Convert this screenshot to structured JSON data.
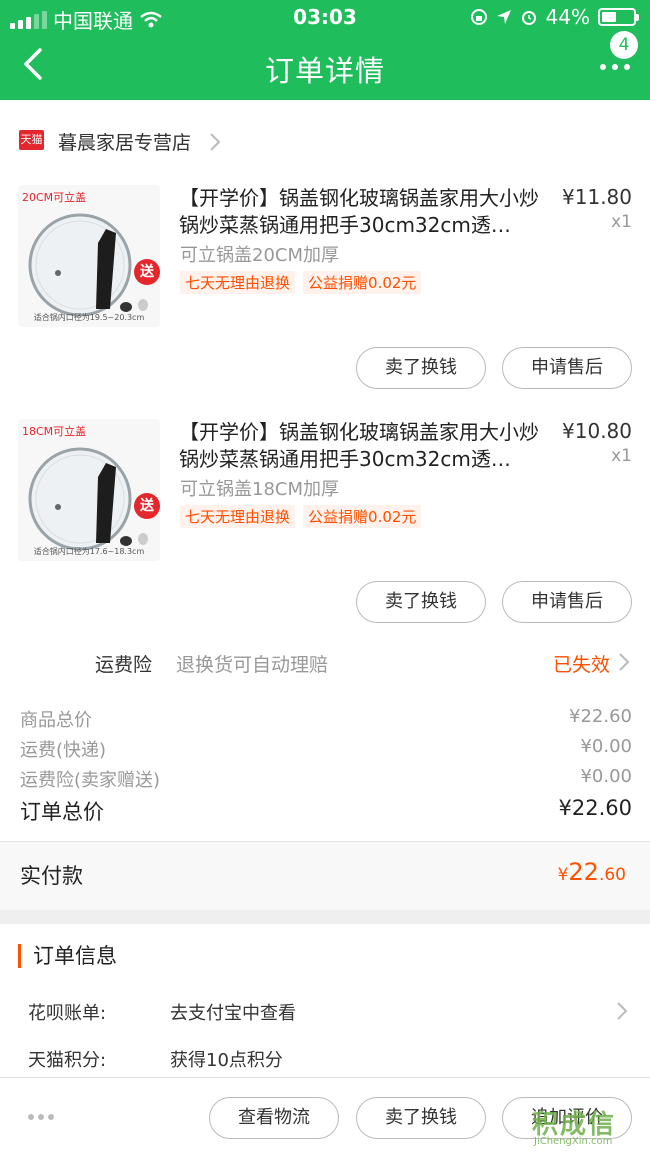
{
  "status_bar": {
    "carrier": "中国联通",
    "time": "03:03",
    "battery": "44%",
    "battery_level": 0.44
  },
  "nav": {
    "title": "订单详情",
    "badge": "4"
  },
  "shop": {
    "logo_text": "天猫",
    "name": "暮晨家居专营店"
  },
  "items": [
    {
      "title": "【开学价】锅盖钢化玻璃锅盖家用大小炒锅炒菜蒸锅通用把手30cm32cm透…",
      "price": "¥11.80",
      "qty": "x1",
      "sku": "可立锅盖20CM加厚",
      "tags": [
        "七天无理由退换",
        "公益捐赠0.02元"
      ],
      "thumb_label": "20CM可立盖",
      "thumb_note": "适合锅内口径为19.5~20.3cm",
      "thumb_gift": "送",
      "actions": [
        "卖了换钱",
        "申请售后"
      ]
    },
    {
      "title": "【开学价】锅盖钢化玻璃锅盖家用大小炒锅炒菜蒸锅通用把手30cm32cm透…",
      "price": "¥10.80",
      "qty": "x1",
      "sku": "可立锅盖18CM加厚",
      "tags": [
        "七天无理由退换",
        "公益捐赠0.02元"
      ],
      "thumb_label": "18CM可立盖",
      "thumb_note": "适合锅内口径为17.6~18.3cm",
      "thumb_gift": "送",
      "actions": [
        "卖了换钱",
        "申请售后"
      ]
    }
  ],
  "insurance": {
    "label": "运费险",
    "desc": "退换货可自动理赔",
    "status": "已失效"
  },
  "fees": [
    {
      "label": "商品总价",
      "value": "¥22.60"
    },
    {
      "label": "运费(快递)",
      "value": "¥0.00"
    },
    {
      "label": "运费险(卖家赠送)",
      "value": "¥0.00"
    }
  ],
  "total": {
    "label": "订单总价",
    "value": "¥22.60"
  },
  "paid": {
    "label": "实付款",
    "currency": "¥",
    "int": "22",
    "dec": ".60"
  },
  "order_info": {
    "title": "订单信息",
    "rows": [
      {
        "label": "花呗账单:",
        "value": "去支付宝中查看"
      },
      {
        "label": "天猫积分:",
        "value": "获得10点积分"
      }
    ]
  },
  "bottom_actions": [
    "查看物流",
    "卖了换钱",
    "追加评价"
  ],
  "watermark": {
    "text": "积成信",
    "url": "JiChengXin.com"
  },
  "colors": {
    "brand_green": "#1fbd5c",
    "accent_orange": "#ff5000",
    "tmall_red": "#e4262d"
  }
}
